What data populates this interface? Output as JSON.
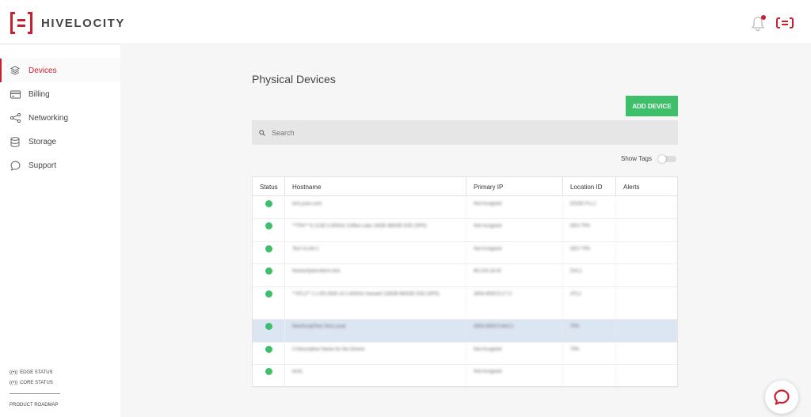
{
  "header": {
    "brand": "HIVELOCITY",
    "has_notification": true,
    "accent_color": "#c8202f"
  },
  "sidebar": {
    "items": [
      {
        "label": "Devices",
        "icon": "layers-icon",
        "active": true
      },
      {
        "label": "Billing",
        "icon": "credit-card-icon",
        "active": false
      },
      {
        "label": "Networking",
        "icon": "share-icon",
        "active": false
      },
      {
        "label": "Storage",
        "icon": "database-icon",
        "active": false
      },
      {
        "label": "Support",
        "icon": "chat-bubble-icon",
        "active": false
      }
    ],
    "edge_status": "EDGE STATUS",
    "core_status": "CORE STATUS",
    "roadmap": "PRODUCT ROADMAP"
  },
  "main": {
    "title": "Physical Devices",
    "add_button": "ADD DEVICE",
    "add_button_color": "#3ec06a",
    "search_placeholder": "Search",
    "show_tags_label": "Show Tags",
    "show_tags_on": false,
    "table": {
      "columns": [
        "Status",
        "Hostname",
        "Primary IP",
        "Location ID",
        "Alerts"
      ],
      "rows": [
        {
          "status": "online",
          "hostname": "test.yuan.com",
          "ip": "Not Assigned",
          "location": "EDGE-FLL1",
          "selected": false
        },
        {
          "status": "online",
          "hostname": "**TPA** E-2136 3.30GHz Coffee Lake 16GB 480GB SSD (SPS)",
          "ip": "Not Assigned",
          "location": "DEV TPA",
          "selected": false
        },
        {
          "status": "online",
          "hostname": "Test VLAN 2",
          "ip": "Not Assigned",
          "location": "DEV TPA",
          "selected": false
        },
        {
          "status": "online",
          "hostname": "hivelocityterraform.test",
          "ip": "66.216.18.42",
          "location": "DAL1",
          "selected": false
        },
        {
          "status": "online",
          "hostname": "**ATL2** 2 x E5-2630 v3 2.40GHz Haswell 128GB 960GB SSD (SPS)",
          "ip": "2604:4500:5:2:7:2",
          "location": "ATL2",
          "selected": false
        },
        {
          "status": "online",
          "hostname": "NewScriptTest.Test.Local",
          "ip": "2604:4500:0:4e2:2",
          "location": "TPA",
          "selected": true
        },
        {
          "status": "online",
          "hostname": "A Descriptive Name for the Device",
          "ip": "Not Assigned",
          "location": "TPA",
          "selected": false
        },
        {
          "status": "online",
          "hostname": "test1",
          "ip": "Not Assigned",
          "location": "",
          "selected": false
        }
      ]
    }
  }
}
